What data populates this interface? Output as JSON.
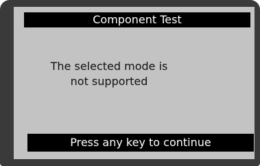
{
  "screen": {
    "title": "Component Test",
    "message_line1": "The selected mode is",
    "message_line2": "not supported",
    "footer": "Press any key to continue"
  },
  "colors": {
    "frame": "#3a3a3a",
    "screen_background": "#c3c3c3",
    "bar_background": "#000000",
    "bar_text": "#ffffff",
    "body_text": "#111111"
  }
}
